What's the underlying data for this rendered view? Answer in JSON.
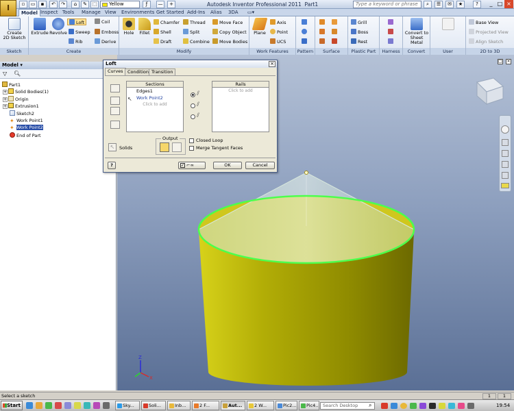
{
  "window": {
    "app_title": "Autodesk Inventor Professional 2011",
    "doc_title": "Part1",
    "color_value": "Yellow",
    "search_placeholder": "Type a keyword or phrase"
  },
  "tabs": [
    "Model",
    "Inspect",
    "Tools",
    "Manage",
    "View",
    "Environments",
    "Get Started",
    "Add-Ins",
    "Alias",
    "3DA"
  ],
  "ribbon": {
    "sketch": {
      "panel": "Sketch",
      "create2d": "Create",
      "create2d_sub": "2D Sketch"
    },
    "create": {
      "panel": "Create",
      "extrude": "Extrude",
      "revolve": "Revolve",
      "loft": "Loft",
      "sweep": "Sweep",
      "rib": "Rib",
      "coil": "Coil",
      "emboss": "Emboss",
      "derive": "Derive"
    },
    "modify": {
      "panel": "Modify",
      "hole": "Hole",
      "fillet": "Fillet",
      "chamfer": "Chamfer",
      "shell": "Shell",
      "draft": "Draft",
      "thread": "Thread",
      "split": "Split",
      "combine": "Combine",
      "moveface": "Move Face",
      "copyobject": "Copy Object",
      "movebodies": "Move Bodies"
    },
    "workfeatures": {
      "panel": "Work Features",
      "plane": "Plane",
      "axis": "Axis",
      "point": "Point",
      "ucs": "UCS"
    },
    "pattern": {
      "panel": "Pattern"
    },
    "surface": {
      "panel": "Surface"
    },
    "plastic": {
      "panel": "Plastic Part",
      "grill": "Grill",
      "boss": "Boss",
      "rest": "Rest"
    },
    "harness": {
      "panel": "Harness"
    },
    "convert": {
      "panel": "Convert",
      "tosheet": "Convert to",
      "tosheet2": "Sheet Metal"
    },
    "usercommands": {
      "panel": "User Commands"
    },
    "to3d": {
      "panel": "2D to 3D",
      "baseview": "Base View",
      "projectedview": "Projected View",
      "alignsketch": "Align Sketch"
    }
  },
  "browser": {
    "title": "Model",
    "nodes": [
      "Part1",
      "Solid Bodies(1)",
      "Origin",
      "Extrusion1",
      "Sketch2",
      "Work Point1",
      "Work Point2",
      "End of Part"
    ]
  },
  "loft": {
    "title": "Loft",
    "tabs": [
      "Curves",
      "Conditions",
      "Transition"
    ],
    "sections_header": "Sections",
    "sections": [
      "Edges1",
      "Work Point2"
    ],
    "click_to_add": "Click to add",
    "rails_header": "Rails",
    "solids_label": "Solids",
    "output_label": "Output",
    "closed_loop": "Closed Loop",
    "merge_tangent": "Merge Tangent Faces",
    "ok": "OK",
    "cancel": "Cancel",
    "help": "?"
  },
  "status": {
    "message": "Select a sketch",
    "field1": "1",
    "field2": "1"
  },
  "taskbar": {
    "start": "Start",
    "items": [
      "Sky...",
      "Soli...",
      "Inb...",
      "2 F...",
      "Aut...",
      "2 W...",
      "Pic2...",
      "Pic4..."
    ],
    "search": "Search Desktop",
    "time": "19:54"
  },
  "colors": {
    "cylinder": "#a8a400",
    "edge_highlight": "#4cff4c",
    "viewport_top": "#b4c1d6",
    "viewport_bottom": "#5a6f95"
  }
}
